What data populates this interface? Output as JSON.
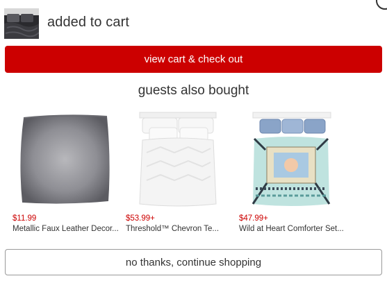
{
  "header": {
    "title": "added to cart",
    "thumbnail_icon": "bedding-thumbnail"
  },
  "checkout": {
    "label": "view cart & check out",
    "color": "#cc0000"
  },
  "recommendations": {
    "title": "guests also bought",
    "items": [
      {
        "price": "$11.99",
        "name": "Metallic Faux Leather Decor...",
        "image": "silver-pillow"
      },
      {
        "price": "$53.99+",
        "name": "Threshold™ Chevron Te...",
        "image": "white-bedding"
      },
      {
        "price": "$47.99+",
        "name": "Wild at Heart Comforter Set...",
        "image": "patterned-comforter"
      }
    ]
  },
  "dismiss": {
    "label": "no thanks, continue shopping"
  },
  "colors": {
    "accent": "#cc0000",
    "text": "#333333",
    "price": "#cc0000"
  }
}
